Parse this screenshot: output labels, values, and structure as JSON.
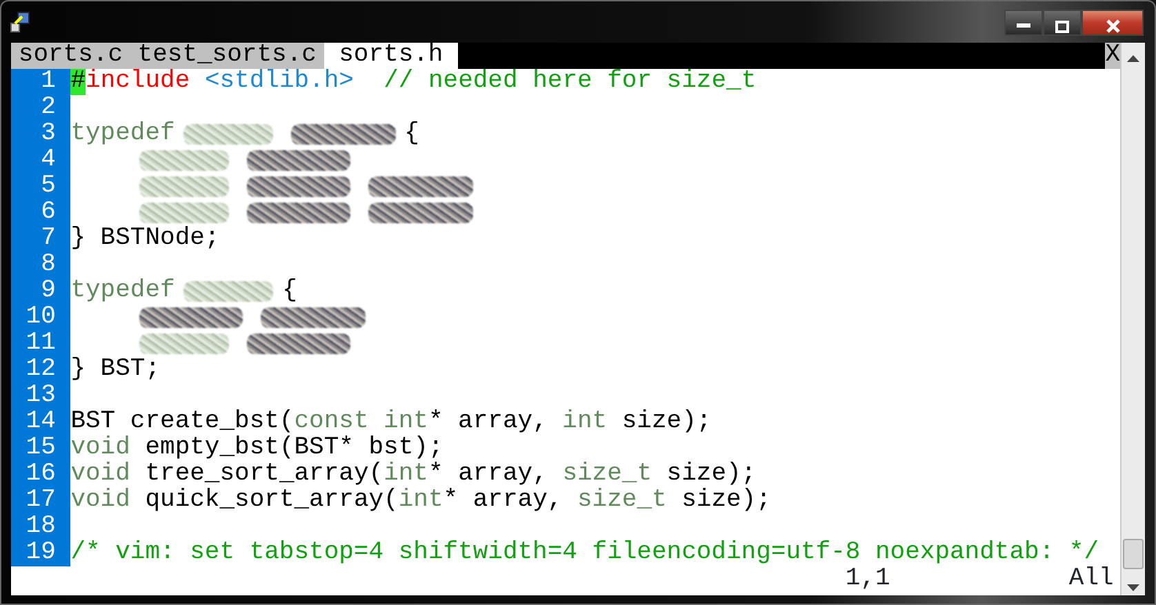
{
  "tabs": [
    {
      "label": "sorts.c",
      "selected": false
    },
    {
      "label": "test_sorts.c",
      "selected": false
    },
    {
      "label": "sorts.h",
      "selected": true
    }
  ],
  "tabline_close": "X",
  "lines": [
    {
      "number": "1",
      "segments": [
        {
          "text": "#",
          "kind": "cursor"
        },
        {
          "text": "include",
          "kind": "preproc"
        },
        {
          "text": " <stdlib.h>",
          "kind": "string"
        },
        {
          "text": "  // needed here for size_t",
          "kind": "comment"
        }
      ]
    },
    {
      "number": "2"
    },
    {
      "number": "3",
      "segments": [
        {
          "text": "typedef",
          "kind": "type"
        },
        {
          "kind": "redacted-type"
        },
        {
          "kind": "redacted-plain"
        },
        {
          "text": "{",
          "kind": "normal"
        }
      ]
    },
    {
      "number": "4",
      "indented": true,
      "segments": [
        {
          "kind": "redacted-type"
        },
        {
          "kind": "redacted-plain"
        }
      ]
    },
    {
      "number": "5",
      "indented": true,
      "segments": [
        {
          "kind": "redacted-type"
        },
        {
          "kind": "redacted-plain"
        },
        {
          "kind": "redacted-plain"
        }
      ]
    },
    {
      "number": "6",
      "indented": true,
      "segments": [
        {
          "kind": "redacted-type"
        },
        {
          "kind": "redacted-plain"
        },
        {
          "kind": "redacted-plain"
        }
      ]
    },
    {
      "number": "7",
      "segments": [
        {
          "text": "} BSTNode;",
          "kind": "normal"
        }
      ]
    },
    {
      "number": "8"
    },
    {
      "number": "9",
      "segments": [
        {
          "text": "typedef",
          "kind": "type"
        },
        {
          "kind": "redacted-type"
        },
        {
          "text": "{",
          "kind": "normal"
        }
      ]
    },
    {
      "number": "10",
      "indented": true,
      "segments": [
        {
          "kind": "redacted-plain"
        },
        {
          "kind": "redacted-plain"
        }
      ]
    },
    {
      "number": "11",
      "indented": true,
      "segments": [
        {
          "kind": "redacted-type"
        },
        {
          "kind": "redacted-plain"
        }
      ]
    },
    {
      "number": "12",
      "segments": [
        {
          "text": "} BST;",
          "kind": "normal"
        }
      ]
    },
    {
      "number": "13"
    },
    {
      "number": "14",
      "segments": [
        {
          "text": "BST create_bst(",
          "kind": "normal"
        },
        {
          "text": "const int",
          "kind": "type"
        },
        {
          "text": "* array, ",
          "kind": "normal"
        },
        {
          "text": "int",
          "kind": "type"
        },
        {
          "text": " size);",
          "kind": "normal"
        }
      ]
    },
    {
      "number": "15",
      "segments": [
        {
          "text": "void",
          "kind": "type"
        },
        {
          "text": " empty_bst(BST* bst);",
          "kind": "normal"
        }
      ]
    },
    {
      "number": "16",
      "segments": [
        {
          "text": "void",
          "kind": "type"
        },
        {
          "text": " tree_sort_array(",
          "kind": "normal"
        },
        {
          "text": "int",
          "kind": "type"
        },
        {
          "text": "* array, ",
          "kind": "normal"
        },
        {
          "text": "size_t",
          "kind": "type"
        },
        {
          "text": " size);",
          "kind": "normal"
        }
      ]
    },
    {
      "number": "17",
      "segments": [
        {
          "text": "void",
          "kind": "type"
        },
        {
          "text": " quick_sort_array(",
          "kind": "normal"
        },
        {
          "text": "int",
          "kind": "type"
        },
        {
          "text": "* array, ",
          "kind": "normal"
        },
        {
          "text": "size_t",
          "kind": "type"
        },
        {
          "text": " size);",
          "kind": "normal"
        }
      ]
    },
    {
      "number": "18"
    },
    {
      "number": "19",
      "segments": [
        {
          "text": "/* vim: set tabstop=4 shiftwidth=4 fileencoding=utf-8 noexpandtab: */",
          "kind": "comment"
        }
      ]
    }
  ],
  "status": {
    "ruler": "1,1",
    "position": "All"
  }
}
